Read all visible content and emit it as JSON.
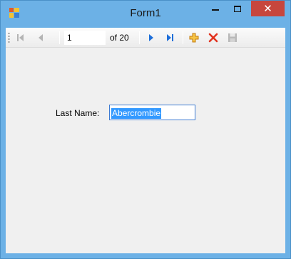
{
  "window": {
    "title": "Form1",
    "close_glyph": "✕"
  },
  "navigator": {
    "position": "1",
    "count_label": "of 20",
    "icons": {
      "first": "move-first-icon",
      "previous": "move-previous-icon",
      "next": "move-next-icon",
      "last": "move-last-icon",
      "add": "add-new-icon",
      "delete": "delete-icon",
      "save": "save-icon"
    },
    "colors": {
      "arrow_active": "#1e6fd9",
      "arrow_disabled": "#b4b4b4",
      "add": "#e8a317",
      "delete": "#e2331f"
    }
  },
  "form": {
    "last_name_label": "Last Name:",
    "last_name_value": "Abercrombie"
  },
  "colors": {
    "titlebar": "#6cb1e6",
    "close_button": "#c7463d",
    "selection": "#3399ff"
  }
}
